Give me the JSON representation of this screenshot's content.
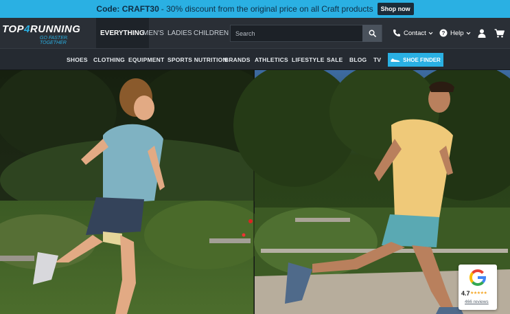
{
  "promo": {
    "code": "Code: CRAFT30",
    "text": "- 30% discount from the original price on all Craft products",
    "button": "Shop now"
  },
  "header": {
    "logo_word_a": "TOP",
    "logo_word_four": "4",
    "logo_word_b": "RUNNING",
    "logo_tagline": "GO FASTER. TOGETHER",
    "segments": [
      "EVERYTHING",
      "MEN'S",
      "LADIES",
      "CHILDREN"
    ],
    "search_placeholder": "Search",
    "contact": "Contact",
    "help": "Help"
  },
  "nav": {
    "items": [
      "SHOES",
      "CLOTHING",
      "EQUIPMENT",
      "SPORTS NUTRITION",
      "BRANDS",
      "ATHLETICS",
      "LIFESTYLE",
      "SALE",
      "BLOG",
      "TV"
    ],
    "finder": "SHOE FINDER"
  },
  "google_badge": {
    "rating": "4.7",
    "stars": "★★★★★",
    "reviews": "466 reviews"
  },
  "colors": {
    "accent": "#2ab0e3",
    "header_bg": "#2a2f36",
    "nav_bg": "#252a31"
  },
  "icons": [
    "search-icon",
    "phone-icon",
    "help-icon",
    "user-icon",
    "cart-icon",
    "shoe-icon",
    "google-g-icon",
    "chevron-down-icon"
  ]
}
